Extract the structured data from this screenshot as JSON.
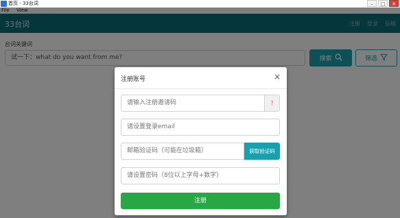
{
  "window": {
    "title": "首页 - 33台词",
    "menu": [
      "File",
      "View"
    ],
    "controls": [
      "–",
      "□",
      "✕"
    ]
  },
  "header": {
    "brand": "33台词",
    "nav": [
      "注册",
      "登录",
      "投稿"
    ]
  },
  "search": {
    "label": "台词关键词",
    "placeholder": "试一下：what do you want from me?",
    "search_button": "搜索",
    "filter_button": "筛选"
  },
  "modal": {
    "title": "注册账号",
    "close": "×",
    "invite_placeholder": "请输入注册邀请码",
    "help_symbol": "?",
    "email_placeholder": "请设置登录email",
    "code_placeholder": "邮箱验证码（可能在垃圾箱）",
    "get_code_button": "获取验证码",
    "password_placeholder": "请设置密码（8位以上字母+数字）",
    "submit_button": "注册"
  }
}
